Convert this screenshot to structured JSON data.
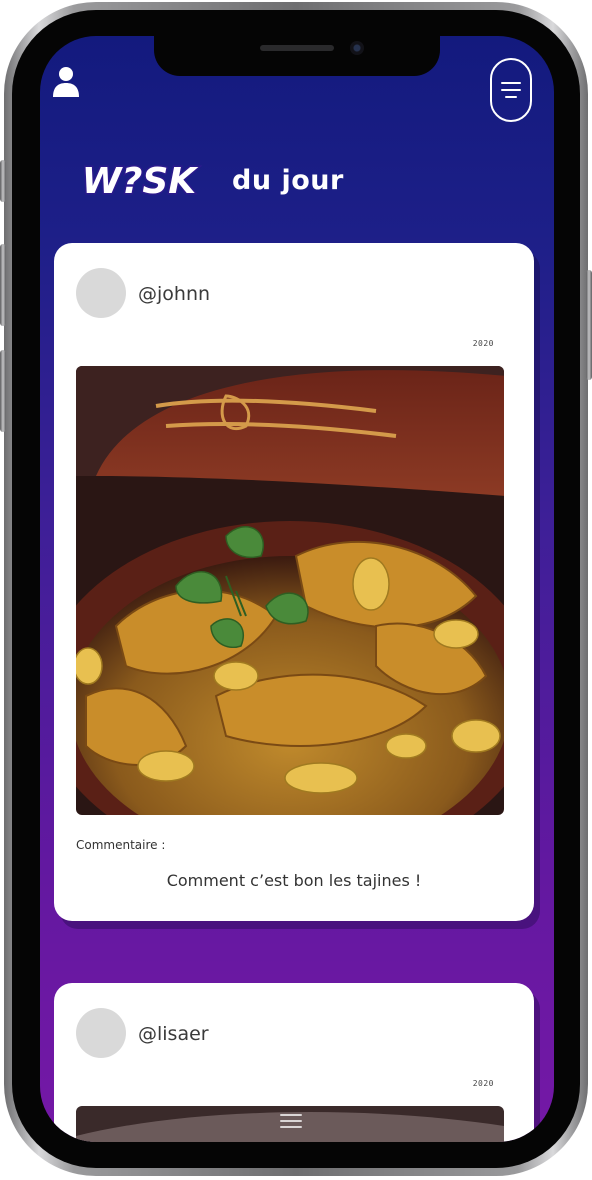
{
  "header": {
    "user_icon": "user-icon",
    "menu_icon": "hamburger-menu-icon",
    "logo_text": "W?SK",
    "title_suffix": "du jour"
  },
  "posts": [
    {
      "username": "@johnn",
      "date": "2020",
      "image": "tajine-dish-photo",
      "comment_label": "Commentaire :",
      "comment": "Comment c’est bon les tajines !"
    },
    {
      "username": "@lisaer",
      "date": "2020",
      "image": "tajine-dish-photo"
    }
  ],
  "colors": {
    "gradient_top": "#131a7e",
    "gradient_bottom": "#7518a6",
    "card": "#ffffff",
    "avatar_placeholder": "#d9d9d9"
  }
}
